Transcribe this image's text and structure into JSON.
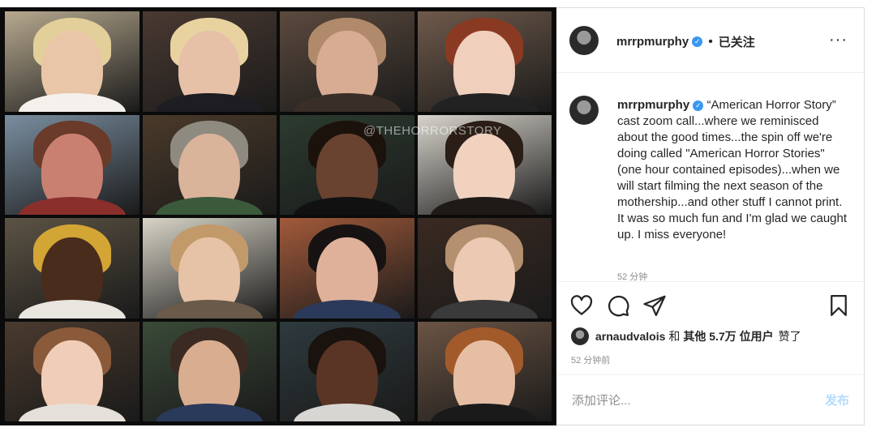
{
  "media": {
    "watermark": "@THEHORRORSTORY",
    "tiles": [
      {
        "bg": "#b7a98f",
        "skin": "#e9c6a8",
        "hair": "#e2cf9a",
        "top": "#f4f1ec",
        "active": true
      },
      {
        "bg": "#4a3a32",
        "skin": "#e7c0a8",
        "hair": "#e8d3a0",
        "top": "#1d1d22",
        "active": false
      },
      {
        "bg": "#5c4a3e",
        "skin": "#d8ab93",
        "hair": "#b08a6a",
        "top": "#3a2e28",
        "active": false
      },
      {
        "bg": "#6f5a4b",
        "skin": "#f0cfbd",
        "hair": "#8a3a22",
        "top": "#222",
        "active": false
      },
      {
        "bg": "#7a8ea0",
        "skin": "#c98070",
        "hair": "#6a3a2a",
        "top": "#8b2f2c",
        "active": false
      },
      {
        "bg": "#4a3a2a",
        "skin": "#d9b39a",
        "hair": "#8f8a80",
        "top": "#3b5a3c",
        "active": false
      },
      {
        "bg": "#2c3b2f",
        "skin": "#6a4330",
        "hair": "#1c120c",
        "top": "#111",
        "active": false
      },
      {
        "bg": "#d8d4cc",
        "skin": "#f0d2bf",
        "hair": "#2a1e17",
        "top": "#1f1a17",
        "active": false
      },
      {
        "bg": "#5c5344",
        "skin": "#4a2c1c",
        "hair": "#d3a534",
        "top": "#e9e6e0",
        "active": false
      },
      {
        "bg": "#d8d4c7",
        "skin": "#e6c2a6",
        "hair": "#c29a6a",
        "top": "#6a5a4a",
        "active": false
      },
      {
        "bg": "#a25a3a",
        "skin": "#e0b19a",
        "hair": "#171312",
        "top": "#2b3a5a",
        "active": false
      },
      {
        "bg": "#3a2a22",
        "skin": "#ecc9b3",
        "hair": "#b49070",
        "top": "#3a3a3a",
        "active": false
      },
      {
        "bg": "#4a3a2e",
        "skin": "#f0cdb8",
        "hair": "#8a5a3a",
        "top": "#e6e0da",
        "active": false
      },
      {
        "bg": "#3a4a38",
        "skin": "#d9ad90",
        "hair": "#3a2a22",
        "top": "#2a3a5a",
        "active": false
      },
      {
        "bg": "#2e3a3e",
        "skin": "#5a3424",
        "hair": "#1a120e",
        "top": "#d8d6d2",
        "active": false
      },
      {
        "bg": "#6b5444",
        "skin": "#e6bea4",
        "hair": "#a35a2a",
        "top": "#1a1a1a",
        "active": false
      }
    ]
  },
  "post": {
    "username": "mrrpmurphy",
    "verified_glyph": "✓",
    "separator": "•",
    "follow_label": "已关注",
    "more_label": "···",
    "caption_text": "“American Horror Story” cast zoom call...where we reminisced about the good times...the spin off we're doing called \"American Horror Stories\" (one hour contained episodes)...when we will start filming the next season of the mothership...and other stuff I cannot print. It was so much fun and I'm glad we caught up. I miss everyone!",
    "caption_time": "52 分钟",
    "likes": {
      "user": "arnaudvalois",
      "connector": "和",
      "others": "其他 5.7万 位用户",
      "suffix": "赞了"
    },
    "post_time": "52 分钟前",
    "comment_placeholder": "添加评论...",
    "post_button": "发布"
  },
  "icons": [
    "heart-icon",
    "comment-icon",
    "share-icon",
    "bookmark-icon",
    "verified-icon",
    "more-icon"
  ],
  "colors": {
    "active_tile_border": "#7ddc3a",
    "verified_blue": "#3897f0",
    "post_button_disabled": "#b3dbff",
    "muted_text": "#8e8e8e"
  }
}
